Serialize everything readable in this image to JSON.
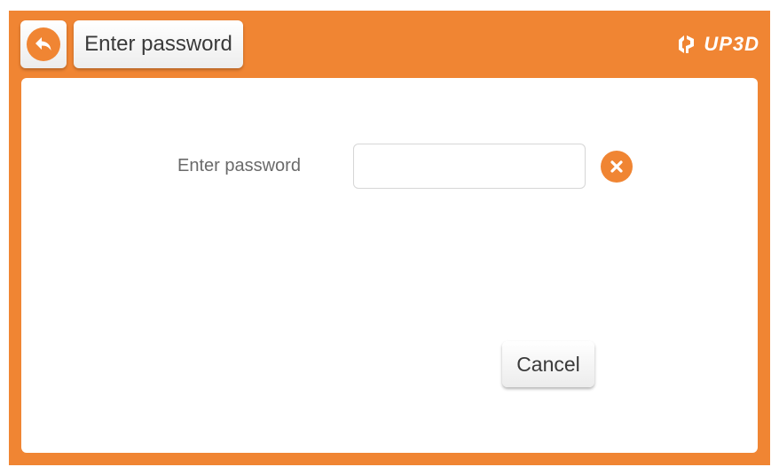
{
  "header": {
    "title": "Enter password",
    "logo_text": "UP3D"
  },
  "form": {
    "label": "Enter password",
    "password_value": ""
  },
  "actions": {
    "cancel_label": "Cancel"
  },
  "icons": {
    "back": "back-arrow-icon",
    "clear": "clear-x-icon",
    "logo": "up3d-logo-icon"
  },
  "colors": {
    "accent": "#f08533",
    "panel": "#ffffff",
    "text": "#3a3a3a",
    "label": "#6a6a6a"
  }
}
